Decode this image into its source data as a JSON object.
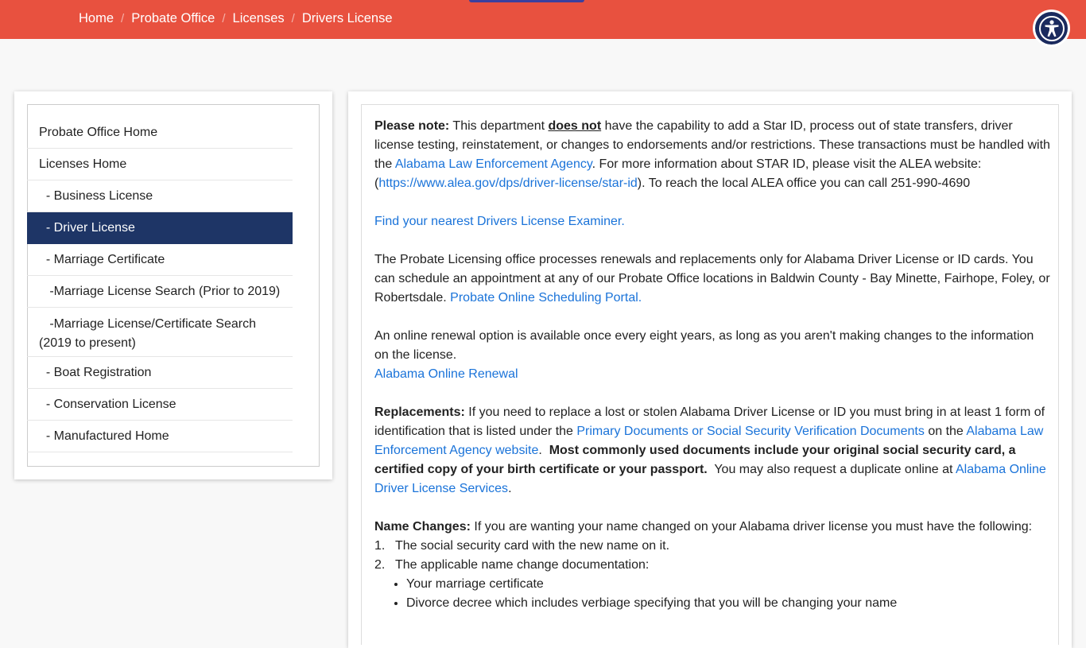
{
  "breadcrumb": [
    "Home",
    "Probate Office",
    "Licenses",
    "Drivers License"
  ],
  "breadcrumb_separator": "/",
  "accessibility_button": {
    "icon": "accessibility-icon"
  },
  "sidebar": {
    "items": [
      {
        "label": "Probate Office Home",
        "active": false
      },
      {
        "label": "Licenses Home",
        "active": false
      },
      {
        "label": "  - Business License",
        "active": false
      },
      {
        "label": "  - Driver License",
        "active": true
      },
      {
        "label": "  - Marriage Certificate",
        "active": false
      },
      {
        "label": "   -Marriage License Search (Prior to 2019)",
        "active": false
      },
      {
        "label_line1": "   -Marriage License/Certificate Search",
        "label_line2": "(2019 to present)",
        "active": false
      },
      {
        "label": "  - Boat Registration",
        "active": false
      },
      {
        "label": "  - Conservation License",
        "active": false
      },
      {
        "label": "  - Manufactured Home",
        "active": false
      }
    ]
  },
  "content": {
    "note": {
      "lead": "Please note:",
      "t1": " This department ",
      "emph": "does not",
      "t2": " have the capability to add a Star ID, process out of state transfers, driver license testing, reinstatement, or changes to endorsements and/or restrictions. These transactions must be handled with the ",
      "link1": "Alabama Law Enforcement Agency",
      "t3": ". For more information about STAR ID, please visit the ALEA website: (",
      "link2": "https://www.alea.gov/dps/driver-license/star-id",
      "t4": "). To reach the local ALEA office you can call 251-990-4690"
    },
    "examiner_link": "Find your nearest Drivers License Examiner.",
    "renewals": {
      "text": "The Probate Licensing office processes renewals and replacements only for Alabama Driver License or ID cards. You can schedule an appointment at any of our Probate Office locations in Baldwin County - Bay Minette, Fairhope, Foley, or Robertsdale. ",
      "link": "Probate Online Scheduling Portal."
    },
    "online": {
      "text": "An online renewal option is available once every eight years, as long as you aren't making changes to the information on the license.",
      "link": "Alabama Online Renewal"
    },
    "replacements": {
      "lead": "Replacements:",
      "t1": " If you need to replace a lost or stolen Alabama Driver License or ID you must bring in at least 1 form of identification that is listed under the ",
      "link1": "Primary Documents or Social Security Verification Documents",
      "t2": " on the ",
      "link2": "Alabama Law Enforcement Agency website",
      "t3": ".  ",
      "bold": "Most commonly used documents include your original social security card, a certified copy of your birth certificate or your passport.",
      "t4": "  You may also request a duplicate online at ",
      "link3": "Alabama Online Driver License Services",
      "t5": "."
    },
    "name_changes": {
      "lead": "Name Changes:",
      "text": " If you are wanting your name changed on your Alabama driver license you must have the following:",
      "steps": [
        {
          "num": "1.",
          "text": "The social security card with the new name on it."
        },
        {
          "num": "2.",
          "text": "The applicable name change documentation:"
        }
      ],
      "bullets": [
        "Your marriage certificate",
        "Divorce decree which includes verbiage specifying that you will be changing your name"
      ]
    }
  }
}
